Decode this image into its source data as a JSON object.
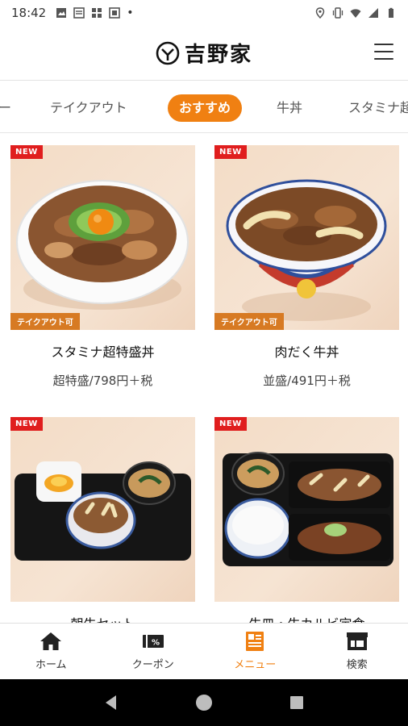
{
  "status_bar": {
    "time": "18:42",
    "left_icons": [
      "image-icon",
      "news-icon",
      "grid-icon",
      "app-icon"
    ],
    "right_icons": [
      "location-icon",
      "vibrate-icon",
      "wifi-icon",
      "signal-icon",
      "battery-icon"
    ]
  },
  "header": {
    "logo_text": "吉野家",
    "menu_icon": "hamburger-icon"
  },
  "tabs": [
    {
      "label": "ー"
    },
    {
      "label": "テイクアウト"
    },
    {
      "label": "おすすめ",
      "active": true
    },
    {
      "label": "牛丼"
    },
    {
      "label": "スタミナ超"
    }
  ],
  "menu_items": [
    {
      "name": "スタミナ超特盛丼",
      "price": "超特盛/798円＋税",
      "new_badge": "NEW",
      "takeout_badge": "テイクアウト可"
    },
    {
      "name": "肉だく牛丼",
      "price": "並盛/491円＋税",
      "new_badge": "NEW",
      "takeout_badge": "テイクアウト可"
    },
    {
      "name": "朝牛セット",
      "price": "",
      "new_badge": "NEW",
      "takeout_badge": ""
    },
    {
      "name": "牛皿・牛カルビ定食",
      "price": "",
      "new_badge": "NEW",
      "takeout_badge": ""
    }
  ],
  "bottom_nav": [
    {
      "label": "ホーム",
      "icon": "home-icon"
    },
    {
      "label": "クーポン",
      "icon": "coupon-icon"
    },
    {
      "label": "メニュー",
      "icon": "menu-book-icon",
      "active": true
    },
    {
      "label": "検索",
      "icon": "store-icon"
    }
  ],
  "colors": {
    "accent": "#f08012",
    "new_badge": "#e01e1e",
    "takeout_badge": "#d77a23"
  }
}
